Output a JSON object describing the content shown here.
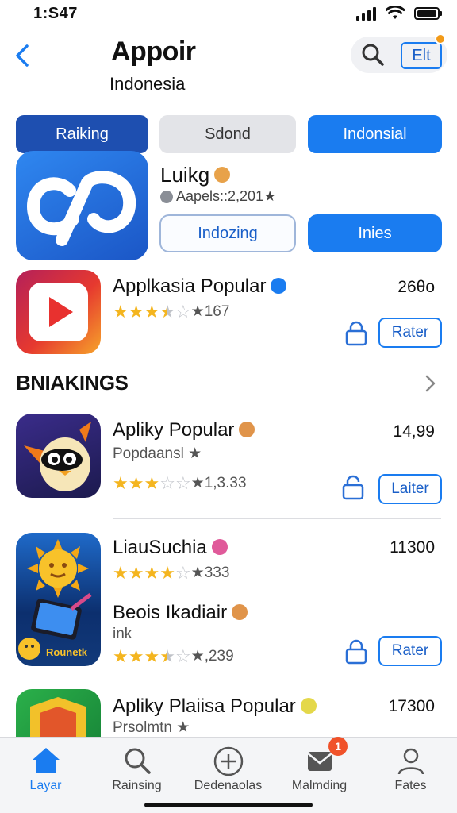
{
  "status": {
    "time": "1:S47"
  },
  "header": {
    "title": "Appoir",
    "subtitle": "Indonesia",
    "edit_label": "Elt"
  },
  "segments": [
    "Raiking",
    "Sdond",
    "Indonsial"
  ],
  "featured": {
    "name": "Luikg",
    "meta": "Aapels::2,201★",
    "button_outline": "Indozing",
    "button_solid": "Inies"
  },
  "apps_top": [
    {
      "name": "Applkasia Popular",
      "rating_count": "★167",
      "stars": 3.5,
      "price": "26θo",
      "button": "Rater"
    }
  ],
  "section": {
    "title": "BNIAKINGS"
  },
  "apps": [
    {
      "name": "Apliky Popular",
      "subtitle": "Popdaansl ★",
      "rating_count": "★1,3.33",
      "stars": 3,
      "price": "14,99",
      "button": "Laiter"
    },
    {
      "name": "LiauSuchia",
      "rating_count": "★333",
      "stars": 4,
      "price": "11300"
    },
    {
      "name": "Beois Ikadiair",
      "subtitle": "ink",
      "rating_count": "★,239",
      "stars": 3.5,
      "button": "Rater"
    },
    {
      "name": "Apliky Plaiisa Popular",
      "subtitle": "Prsolmtn ★",
      "price": "17300"
    }
  ],
  "icon_texts": {
    "rounetic": "Rounetk"
  },
  "tabbar": {
    "tabs": [
      "Layar",
      "Rainsing",
      "Dedenaolas",
      "Malmding",
      "Fates"
    ],
    "badge": "1"
  },
  "colors": {
    "accent": "#1a7cf0",
    "accent_dark": "#1e4fb0",
    "star": "#f4b51f",
    "badge": "#f0522a"
  }
}
